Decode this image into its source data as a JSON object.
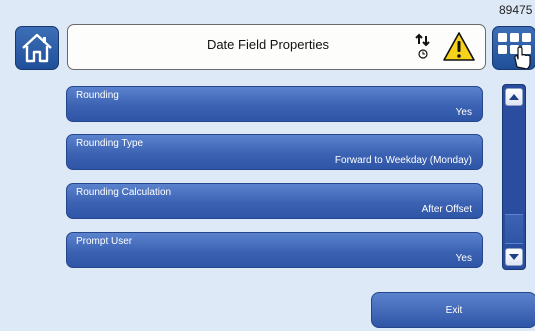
{
  "header": {
    "device_id": "89475",
    "title": "Date Field Properties",
    "home_icon": "home-icon",
    "sort_icon": "sort-order-icon",
    "warning_icon": "warning-icon",
    "apps_icon": "apps-grid-touch-icon"
  },
  "properties": [
    {
      "label": "Rounding",
      "value": "Yes"
    },
    {
      "label": "Rounding Type",
      "value": "Forward to Weekday (Monday)"
    },
    {
      "label": "Rounding Calculation",
      "value": "After Offset"
    },
    {
      "label": "Prompt User",
      "value": "Yes"
    }
  ],
  "footer": {
    "exit_label": "Exit"
  },
  "colors": {
    "background": "#dde9f7",
    "button_blue": "#3c63b3",
    "warning_yellow": "#f6d21b"
  }
}
